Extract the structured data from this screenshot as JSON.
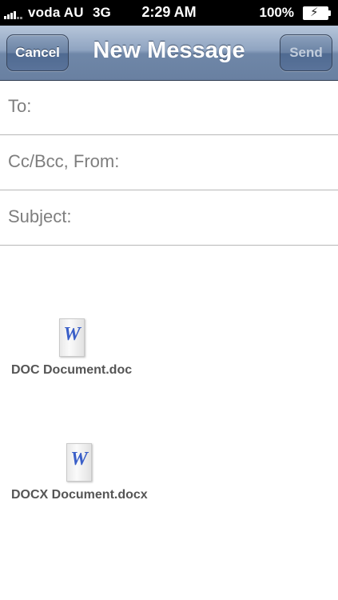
{
  "status_bar": {
    "carrier": "voda AU",
    "network": "3G",
    "time": "2:29 AM",
    "battery_percent": "100%"
  },
  "nav_bar": {
    "title": "New Message",
    "cancel_label": "Cancel",
    "send_label": "Send"
  },
  "fields": {
    "to_label": "To:",
    "cc_bcc_from_label": "Cc/Bcc, From:",
    "subject_label": "Subject:"
  },
  "attachments": [
    {
      "name": "DOC Document.doc",
      "icon": "word-document-icon",
      "icon_letter": "W"
    },
    {
      "name": "DOCX Document.docx",
      "icon": "word-document-icon",
      "icon_letter": "W"
    }
  ],
  "colors": {
    "nav_bar": "#7b91b1",
    "status_bar": "#000000",
    "label_gray": "#7e7e7e",
    "word_blue": "#3a5fc8"
  }
}
